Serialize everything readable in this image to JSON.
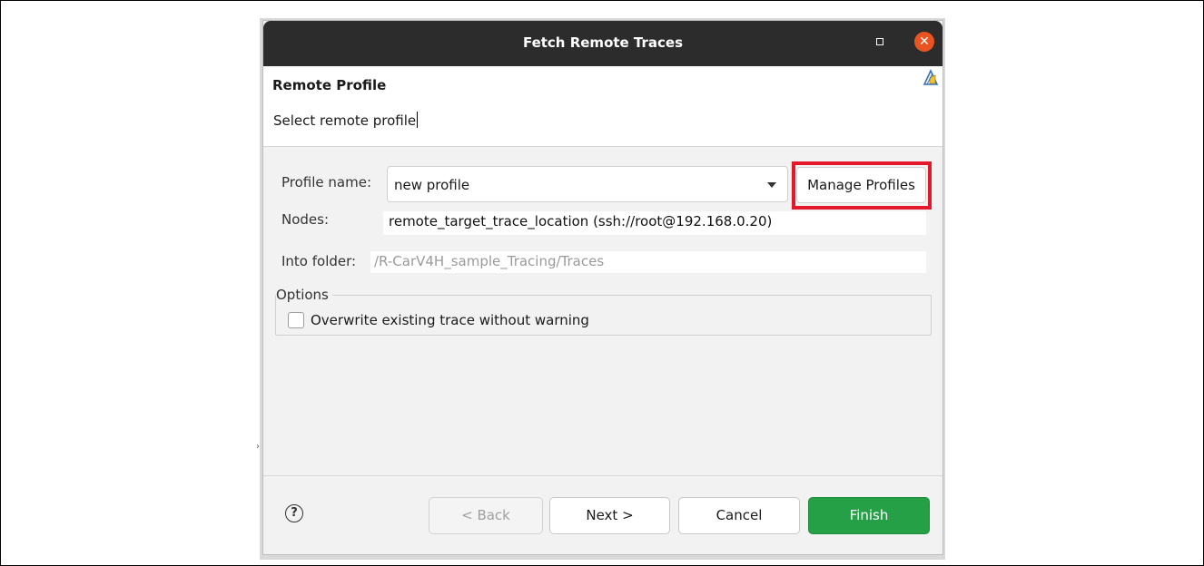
{
  "dialog": {
    "title": "Fetch Remote Traces",
    "header_title": "Remote Profile",
    "header_subtitle": "Select remote profile"
  },
  "form": {
    "profile_label": "Profile name:",
    "profile_value": "new profile",
    "manage_profiles_label": "Manage Profiles",
    "nodes_label": "Nodes:",
    "nodes_value": "remote_target_trace_location (ssh://root@192.168.0.20)",
    "folder_label": "Into folder:",
    "folder_value": "/R-CarV4H_sample_Tracing/Traces"
  },
  "options": {
    "legend": "Options",
    "overwrite_label": "Overwrite existing trace without warning",
    "overwrite_checked": false
  },
  "footer": {
    "help_glyph": "?",
    "back_label": "< Back",
    "next_label": "Next >",
    "cancel_label": "Cancel",
    "finish_label": "Finish"
  },
  "colors": {
    "titlebar": "#2c2c2c",
    "close": "#e95420",
    "finish": "#26a047",
    "highlight": "#e3192b"
  },
  "icons": {
    "close": "close-icon",
    "maximize": "maximize-icon",
    "wizard": "wizard-banner-icon",
    "help": "help-icon",
    "dropdown": "chevron-down-icon"
  }
}
